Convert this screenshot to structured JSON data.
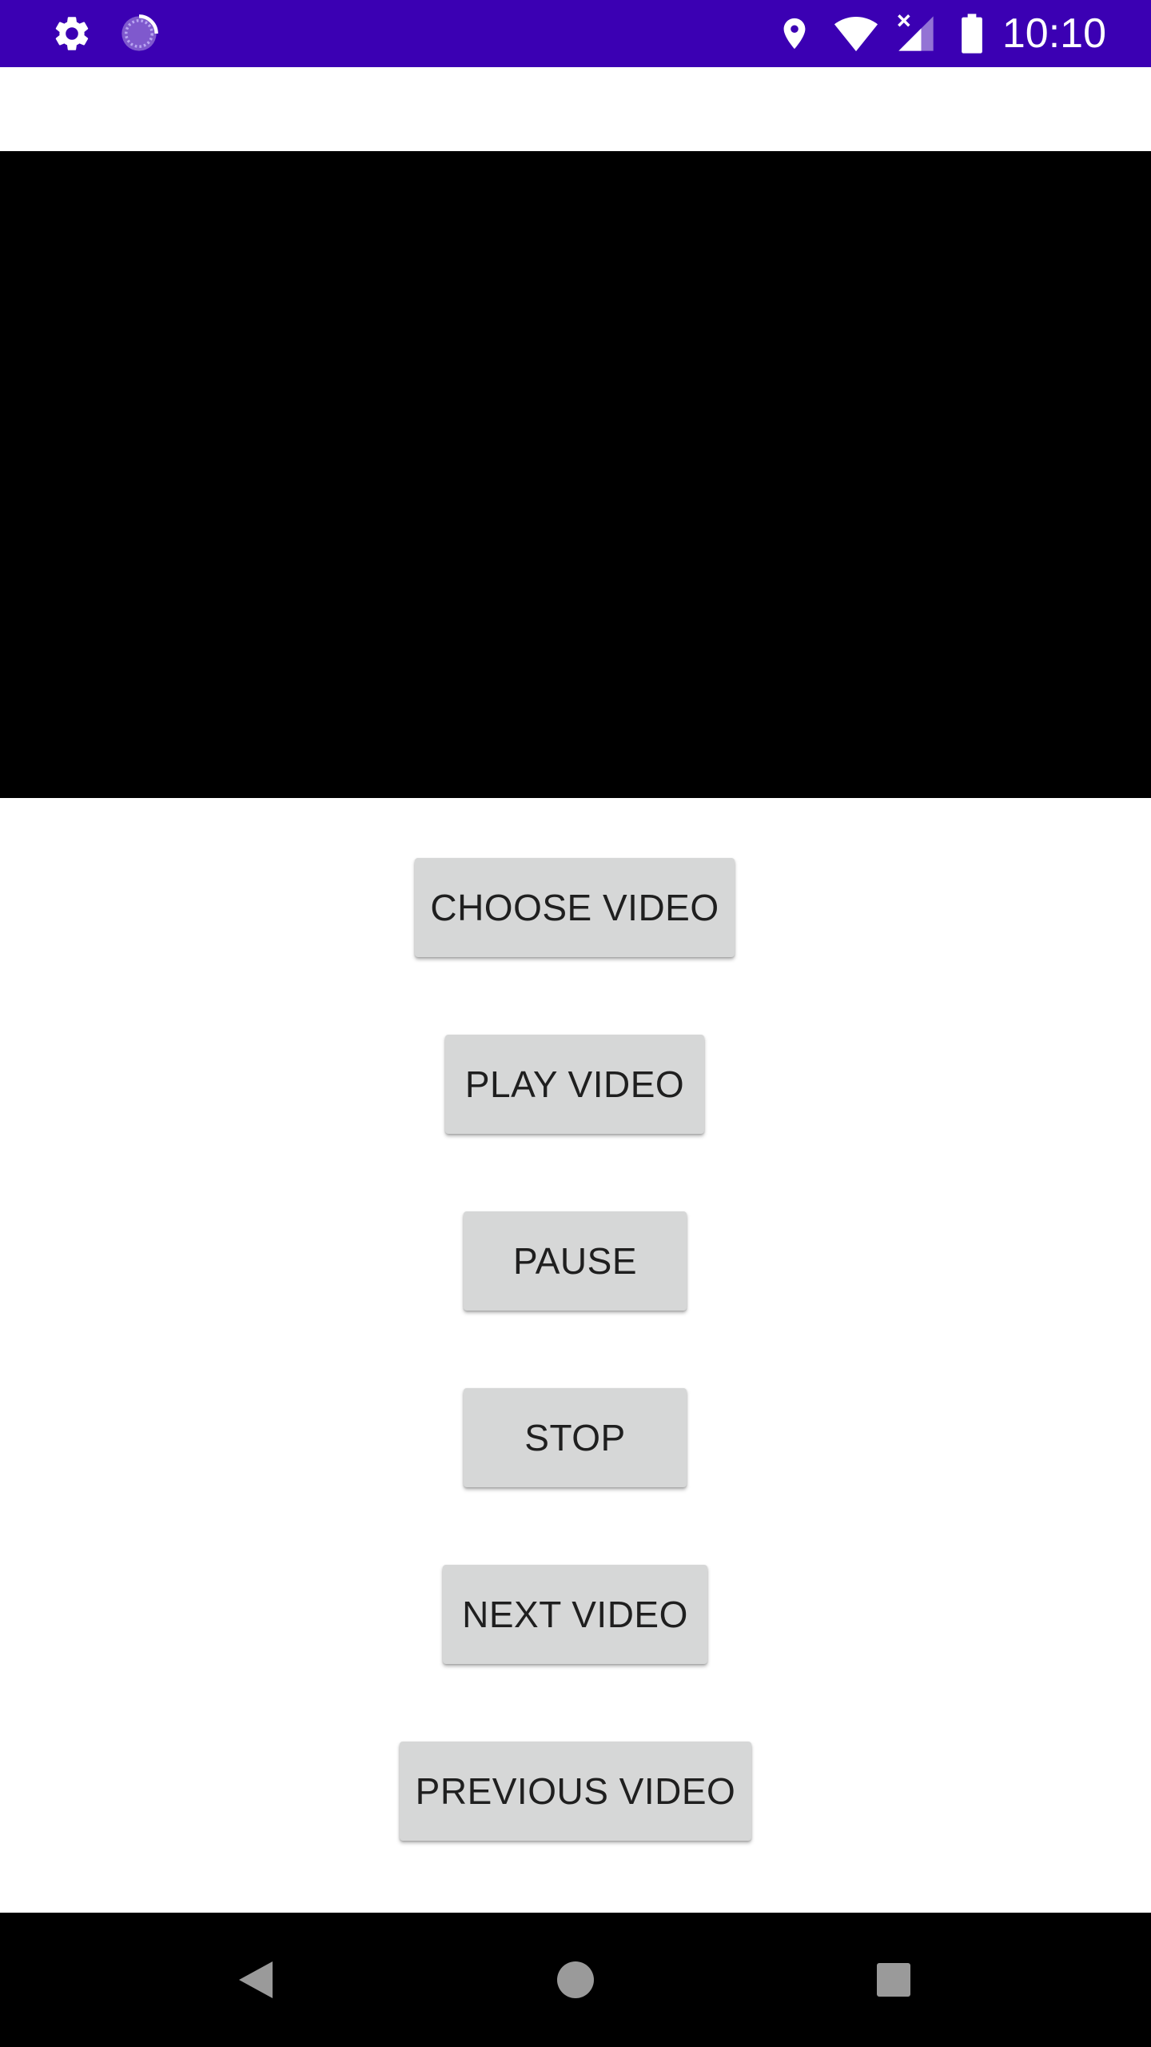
{
  "status_bar": {
    "time": "10:10",
    "background_color": "#3b00b3",
    "icons": [
      "gear-icon",
      "sync-icon",
      "location-icon",
      "wifi-icon",
      "signal-icon",
      "battery-icon"
    ]
  },
  "video": {
    "background_color": "#000000"
  },
  "buttons": {
    "choose_video": "CHOOSE VIDEO",
    "play_video": "PLAY VIDEO",
    "pause": "PAUSE",
    "stop": "STOP",
    "next_video": "NEXT VIDEO",
    "previous_video": "PREVIOUS VIDEO"
  },
  "nav_bar": {
    "icons": [
      "back-icon",
      "home-icon",
      "recents-icon"
    ]
  }
}
